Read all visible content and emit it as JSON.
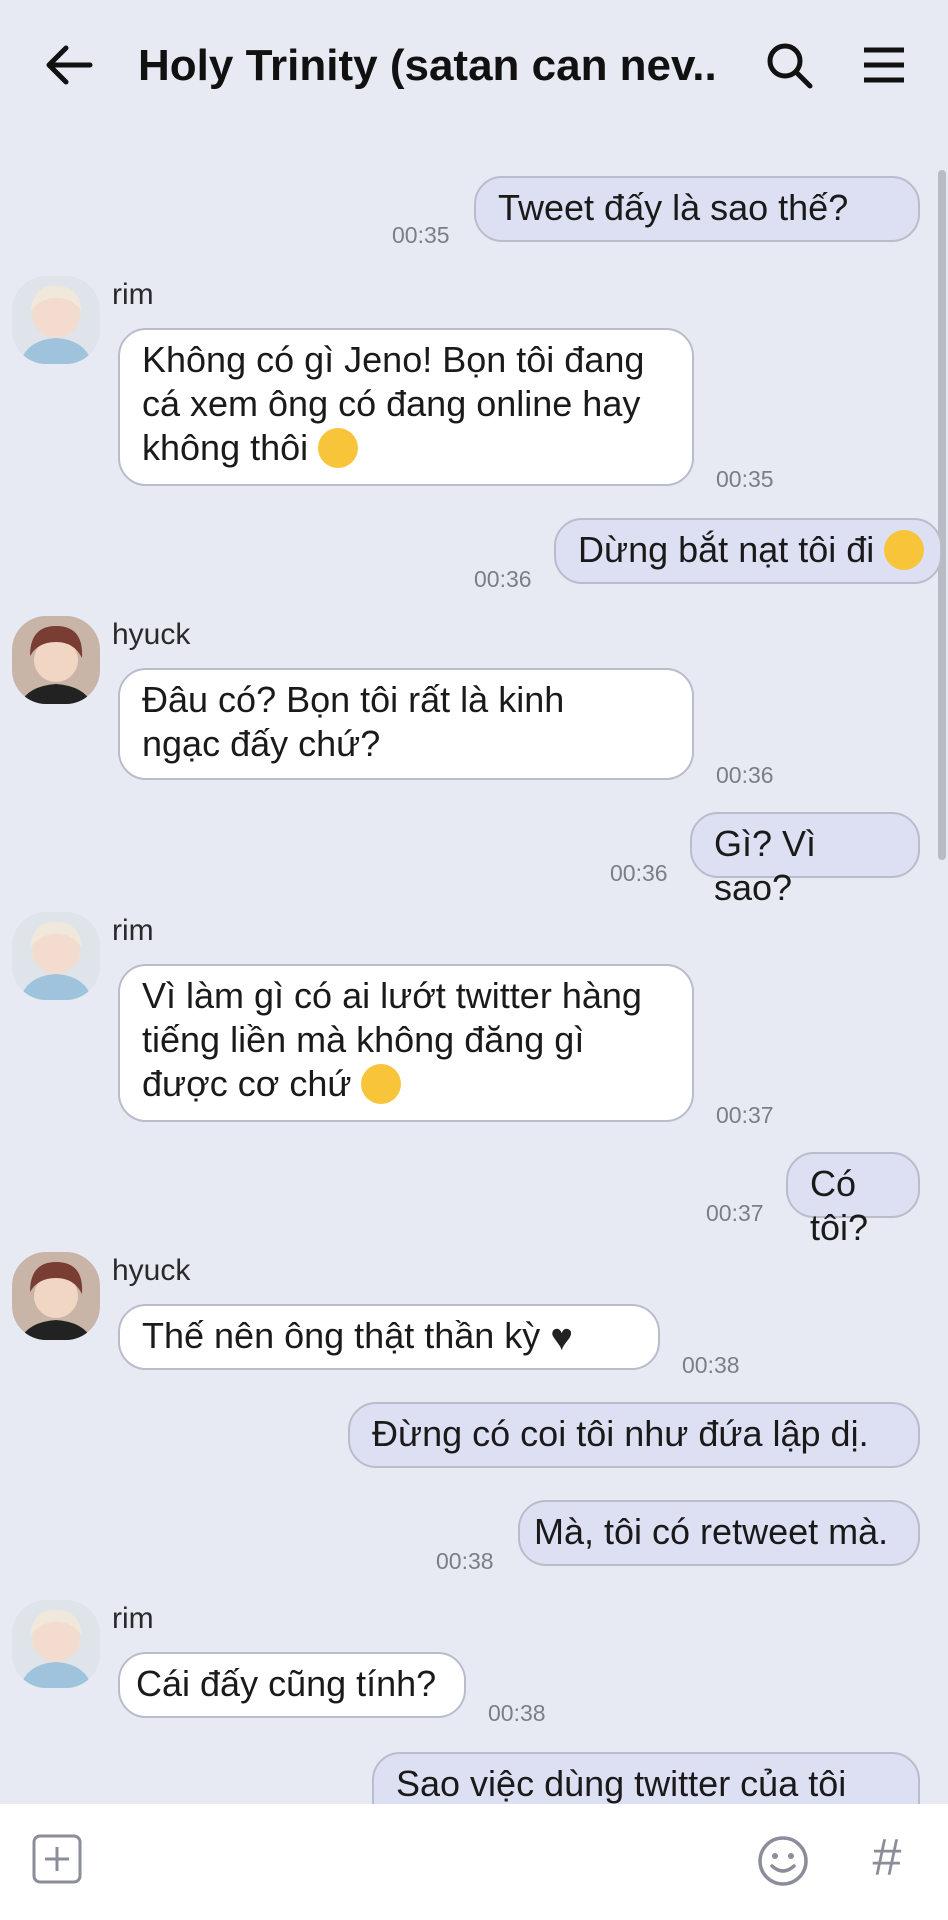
{
  "header": {
    "title": "Holy Trinity (satan can nev..."
  },
  "messages": [
    {
      "text": "Tweet đấy là sao thế?",
      "time": "00:35"
    },
    {
      "sender": "rim",
      "text": "Không có gì Jeno! Bọn tôi đang cá xem ông có đang online hay không thôi",
      "line1": "Không có gì Jeno! Bọn tôi đang",
      "line2": "cá xem ông có đang online hay",
      "line3": "không thôi",
      "time": "00:35"
    },
    {
      "text": "Dừng bắt nạt tôi đi",
      "time": "00:36"
    },
    {
      "sender": "hyuck",
      "line1": "Đâu có? Bọn tôi rất là kinh",
      "line2": "ngạc đấy chứ?",
      "time": "00:36"
    },
    {
      "text": "Gì? Vì sao?",
      "time": "00:36"
    },
    {
      "sender": "rim",
      "line1": "Vì làm gì có ai lướt twitter hàng",
      "line2": "tiếng liền mà không đăng gì",
      "line3": "được cơ chứ",
      "time": "00:37"
    },
    {
      "text": "Có tôi?",
      "time": "00:37"
    },
    {
      "sender": "hyuck",
      "text": "Thế nên ông thật thần kỳ",
      "time": "00:38"
    },
    {
      "text": "Đừng có coi tôi như đứa lập dị."
    },
    {
      "text": "Mà, tôi có retweet mà.",
      "time": "00:38"
    },
    {
      "sender": "rim",
      "text": "Cái đấy cũng tính?",
      "time": "00:38"
    },
    {
      "text": "Sao việc dùng twitter của tôi"
    }
  ],
  "icons": {
    "back": "arrow-left-icon",
    "search": "search-icon",
    "menu": "hamburger-menu-icon",
    "plus": "plus-icon",
    "emoji": "smiley-icon",
    "hash": "#"
  },
  "colors": {
    "background": "#e8eaf3",
    "outgoing_bubble": "#dde0f2",
    "incoming_bubble": "#ffffff",
    "bubble_border": "#b9bccb"
  }
}
